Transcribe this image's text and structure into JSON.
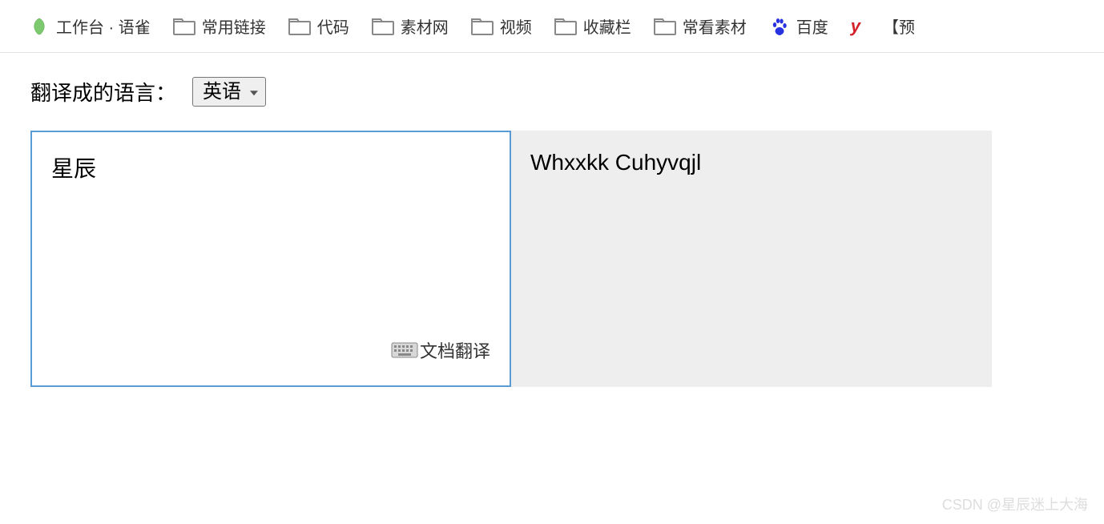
{
  "bookmarks": {
    "yuque_label": "工作台 · 语雀",
    "items": [
      {
        "label": "常用链接"
      },
      {
        "label": "代码"
      },
      {
        "label": "素材网"
      },
      {
        "label": "视频"
      },
      {
        "label": "收藏栏"
      },
      {
        "label": "常看素材"
      }
    ],
    "baidu_label": "百度",
    "y_label": "y",
    "preview_label": "【预"
  },
  "translator": {
    "lang_label": "翻译成的语言：",
    "selected_lang": "英语",
    "input_text": "星辰",
    "output_text": "Whxxkk Cuhyvqjl",
    "doc_translate_label": "文档翻译"
  },
  "watermark": "CSDN @星辰迷上大海"
}
